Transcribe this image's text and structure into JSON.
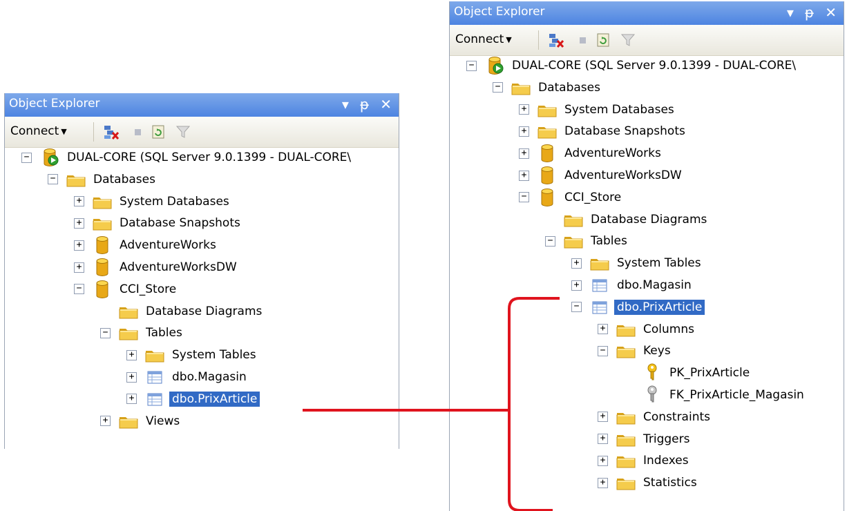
{
  "left_panel": {
    "title": "Object Explorer",
    "connect_label": "Connect",
    "tree": [
      {
        "label": "DUAL-CORE (SQL Server 9.0.1399 - DUAL-CORE\\",
        "icon": "server",
        "toggle": "−",
        "level": 0
      },
      {
        "label": "Databases",
        "icon": "folder",
        "toggle": "−",
        "level": 1
      },
      {
        "label": "System Databases",
        "icon": "folder",
        "toggle": "+",
        "level": 2
      },
      {
        "label": "Database Snapshots",
        "icon": "folder",
        "toggle": "+",
        "level": 2
      },
      {
        "label": "AdventureWorks",
        "icon": "database",
        "toggle": "+",
        "level": 2
      },
      {
        "label": "AdventureWorksDW",
        "icon": "database",
        "toggle": "+",
        "level": 2
      },
      {
        "label": "CCI_Store",
        "icon": "database",
        "toggle": "−",
        "level": 2
      },
      {
        "label": "Database Diagrams",
        "icon": "folder",
        "toggle": "",
        "level": 3
      },
      {
        "label": "Tables",
        "icon": "folder",
        "toggle": "−",
        "level": 3
      },
      {
        "label": "System Tables",
        "icon": "folder",
        "toggle": "+",
        "level": 4
      },
      {
        "label": "dbo.Magasin",
        "icon": "table",
        "toggle": "+",
        "level": 4
      },
      {
        "label": "dbo.PrixArticle",
        "icon": "table",
        "toggle": "+",
        "level": 4,
        "selected": true
      },
      {
        "label": "Views",
        "icon": "folder",
        "toggle": "+",
        "level": 3
      }
    ]
  },
  "right_panel": {
    "title": "Object Explorer",
    "connect_label": "Connect",
    "tree": [
      {
        "label": "DUAL-CORE (SQL Server 9.0.1399 - DUAL-CORE\\",
        "icon": "server",
        "toggle": "−",
        "level": 0
      },
      {
        "label": "Databases",
        "icon": "folder",
        "toggle": "−",
        "level": 1
      },
      {
        "label": "System Databases",
        "icon": "folder",
        "toggle": "+",
        "level": 2
      },
      {
        "label": "Database Snapshots",
        "icon": "folder",
        "toggle": "+",
        "level": 2
      },
      {
        "label": "AdventureWorks",
        "icon": "database",
        "toggle": "+",
        "level": 2
      },
      {
        "label": "AdventureWorksDW",
        "icon": "database",
        "toggle": "+",
        "level": 2
      },
      {
        "label": "CCI_Store",
        "icon": "database",
        "toggle": "−",
        "level": 2
      },
      {
        "label": "Database Diagrams",
        "icon": "folder",
        "toggle": "",
        "level": 3
      },
      {
        "label": "Tables",
        "icon": "folder",
        "toggle": "−",
        "level": 3
      },
      {
        "label": "System Tables",
        "icon": "folder",
        "toggle": "+",
        "level": 4
      },
      {
        "label": "dbo.Magasin",
        "icon": "table",
        "toggle": "+",
        "level": 4
      },
      {
        "label": "dbo.PrixArticle",
        "icon": "table",
        "toggle": "−",
        "level": 4,
        "selected": true
      },
      {
        "label": "Columns",
        "icon": "folder",
        "toggle": "+",
        "level": 5
      },
      {
        "label": "Keys",
        "icon": "folder",
        "toggle": "−",
        "level": 5
      },
      {
        "label": "PK_PrixArticle",
        "icon": "key-gold",
        "toggle": "",
        "level": 6
      },
      {
        "label": "FK_PrixArticle_Magasin",
        "icon": "key-gray",
        "toggle": "",
        "level": 6
      },
      {
        "label": "Constraints",
        "icon": "folder",
        "toggle": "+",
        "level": 5
      },
      {
        "label": "Triggers",
        "icon": "folder",
        "toggle": "+",
        "level": 5
      },
      {
        "label": "Indexes",
        "icon": "folder",
        "toggle": "+",
        "level": 5
      },
      {
        "label": "Statistics",
        "icon": "folder",
        "toggle": "+",
        "level": 5
      }
    ]
  },
  "colors": {
    "titlebar": "#4d84e1",
    "selection": "#316ac5",
    "connector": "#e0141e",
    "folder": "#f5cc4c",
    "database": "#e8a817"
  }
}
